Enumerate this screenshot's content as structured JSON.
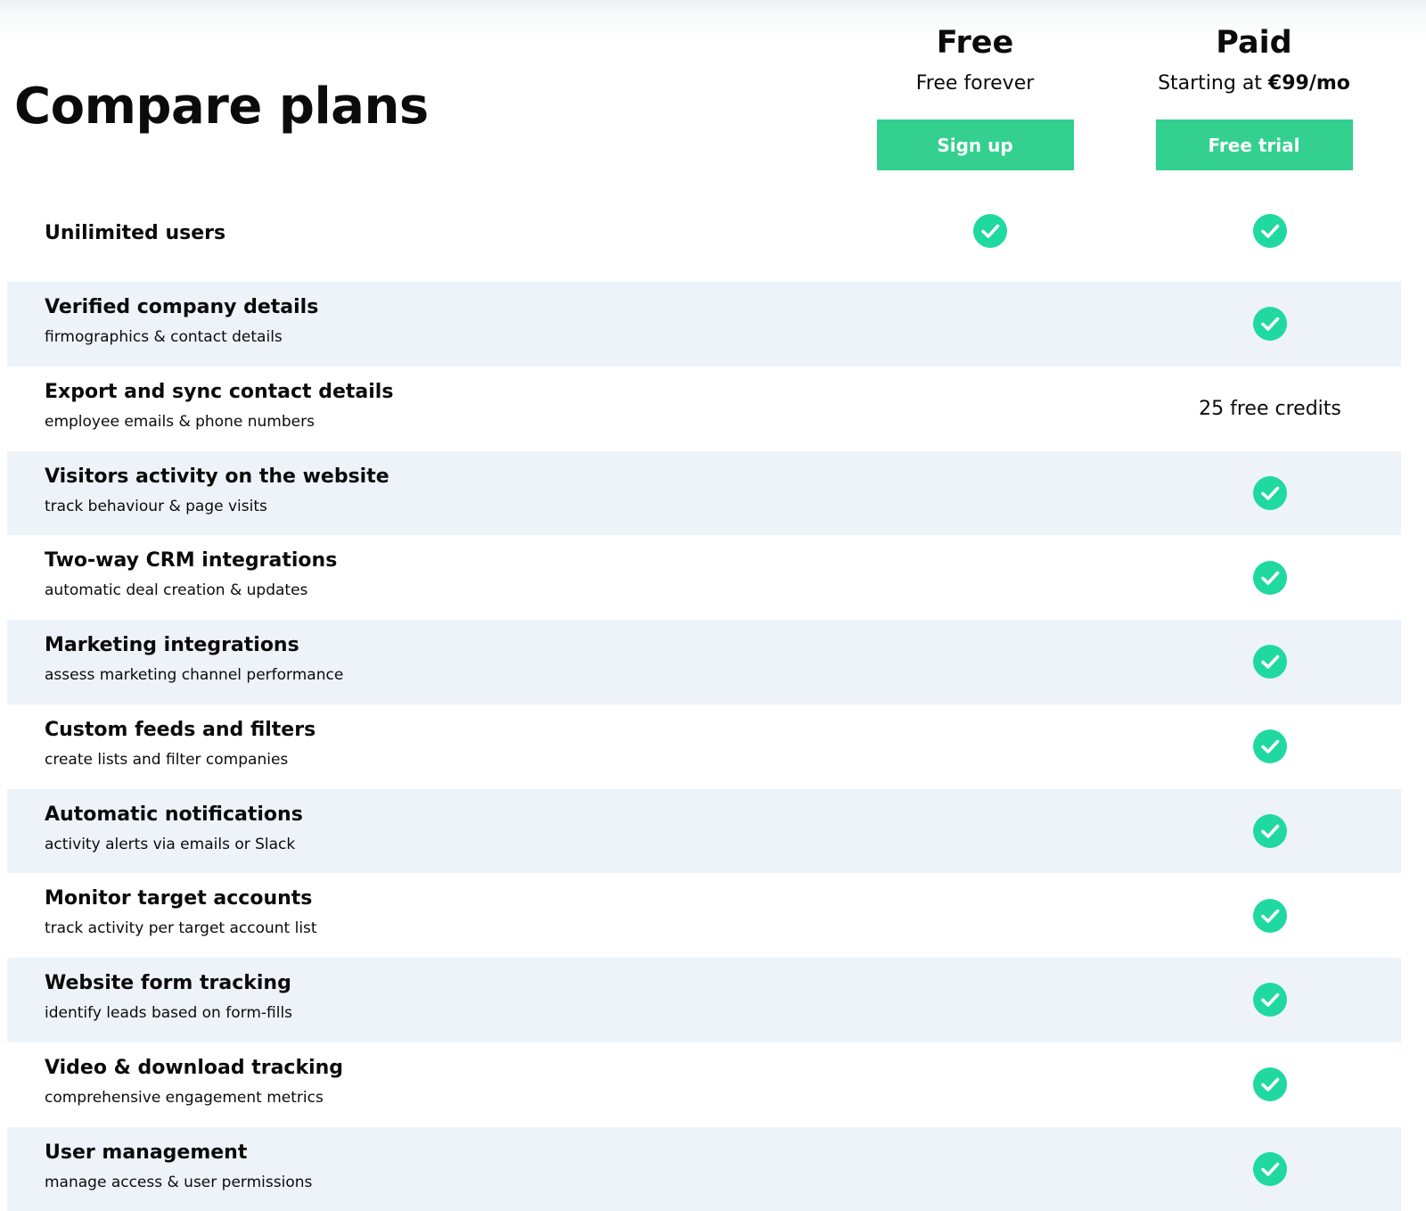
{
  "title": "Compare plans",
  "plans": {
    "free": {
      "name": "Free",
      "price_text": "Free forever",
      "cta": "Sign up"
    },
    "paid": {
      "name": "Paid",
      "price_prefix": "Starting at ",
      "price_value": "€99/mo",
      "cta": "Free trial"
    }
  },
  "colors": {
    "accent": "#33d08f",
    "check": "#20d9a0",
    "row_alt": "#eef3fa",
    "text": "#0b0b0b"
  },
  "features": [
    {
      "title": "Unilimited users",
      "subtitle": "",
      "free": "check",
      "paid": "check"
    },
    {
      "title": "Verified company details",
      "subtitle": "firmographics & contact details",
      "free": "",
      "paid": "check"
    },
    {
      "title": "Export and sync contact details",
      "subtitle": "employee emails & phone numbers",
      "free": "",
      "paid": "25 free credits"
    },
    {
      "title": "Visitors activity on the website",
      "subtitle": "track behaviour & page visits",
      "free": "",
      "paid": "check"
    },
    {
      "title": "Two-way CRM integrations",
      "subtitle": "automatic deal creation & updates",
      "free": "",
      "paid": "check"
    },
    {
      "title": "Marketing integrations",
      "subtitle": "assess marketing channel performance",
      "free": "",
      "paid": "check"
    },
    {
      "title": "Custom feeds and filters",
      "subtitle": "create lists and filter companies",
      "free": "",
      "paid": "check"
    },
    {
      "title": "Automatic notifications",
      "subtitle": "activity alerts via emails or Slack",
      "free": "",
      "paid": "check"
    },
    {
      "title": "Monitor target accounts",
      "subtitle": "track activity per target account list",
      "free": "",
      "paid": "check"
    },
    {
      "title": "Website form tracking",
      "subtitle": "identify leads based on form-fills",
      "free": "",
      "paid": "check"
    },
    {
      "title": "Video & download tracking",
      "subtitle": "comprehensive engagement metrics",
      "free": "",
      "paid": "check"
    },
    {
      "title": "User management",
      "subtitle": "manage access & user permissions",
      "free": "",
      "paid": "check"
    }
  ],
  "icons": {
    "check": "check-circle-icon"
  }
}
